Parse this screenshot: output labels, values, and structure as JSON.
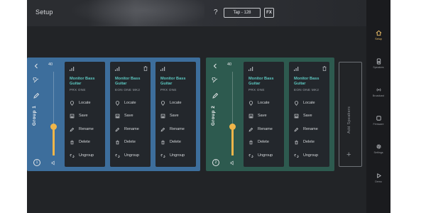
{
  "header": {
    "title": "Setup",
    "help": "?",
    "tap_label": "Tap - 128",
    "fx_label": "FX"
  },
  "nav": {
    "accent": "#f0c26a",
    "items": [
      {
        "label": "Setup",
        "icon": "home-icon"
      },
      {
        "label": "Speakers",
        "icon": "speaker-icon"
      },
      {
        "label": "Broadcast",
        "icon": "broadcast-icon"
      },
      {
        "label": "Firmware",
        "icon": "chip-icon"
      },
      {
        "label": "Settings",
        "icon": "gear-icon"
      },
      {
        "label": "Demo",
        "icon": "play-icon"
      }
    ]
  },
  "groups": [
    {
      "name": "Group 1",
      "number": "1",
      "volume": "40",
      "color": "#3d6e9c",
      "cards": [
        {
          "name": "Monitor Bass Guitar",
          "model": "PRX ONE",
          "trash": false
        },
        {
          "name": "Monitor Bass Guitar",
          "model": "EON ONE MK2",
          "trash": true
        },
        {
          "name": "Monitor Bass Guitar",
          "model": "PRX ONE",
          "trash": false
        }
      ]
    },
    {
      "name": "Group 2",
      "number": "2",
      "volume": "40",
      "color": "#2d5a4f",
      "cards": [
        {
          "name": "Monitor Bass Guitar",
          "model": "PRX ONE",
          "trash": false
        },
        {
          "name": "Monitor Bass Guitar",
          "model": "EON ONE MK2",
          "trash": true
        }
      ]
    }
  ],
  "actions": {
    "locate": "Locate",
    "save": "Save",
    "rename": "Rename",
    "delete": "Delete",
    "ungroup": "Ungroup"
  },
  "add_speakers": {
    "label": "Add Speakers",
    "plus": "+"
  }
}
